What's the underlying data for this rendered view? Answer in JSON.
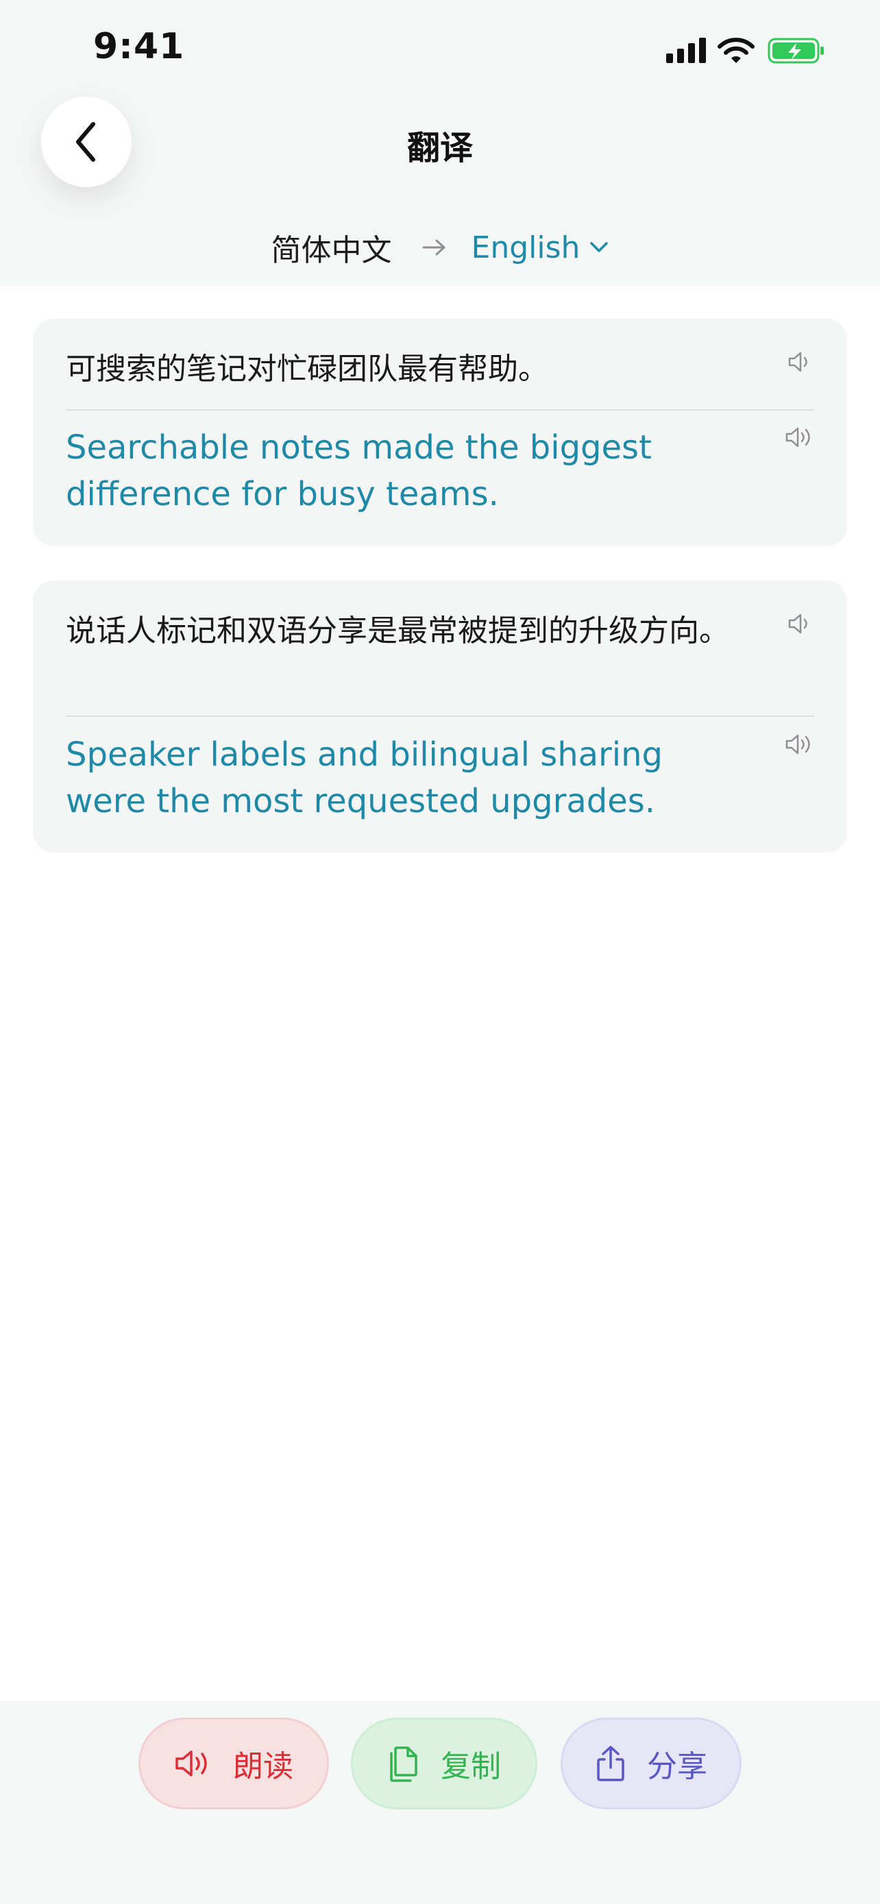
{
  "status_bar": {
    "time": "9:41"
  },
  "header": {
    "title": "翻译"
  },
  "language_bar": {
    "source": "简体中文",
    "target": "English"
  },
  "translations": [
    {
      "source": "可搜索的笔记对忙碌团队最有帮助。",
      "target": "Searchable notes made the biggest difference for busy teams."
    },
    {
      "source": "说话人标记和双语分享是最常被提到的升级方向。",
      "target": "Speaker labels and bilingual sharing were the most requested upgrades."
    }
  ],
  "actions": {
    "read": "朗读",
    "copy": "复制",
    "share": "分享"
  },
  "colors": {
    "accent": "#1e8aa8",
    "read": "#d93038",
    "copy": "#34b451",
    "share": "#5a56c4",
    "battery": "#34c759"
  },
  "icons": {
    "back": "chevron-left-icon",
    "language_arrow": "arrow-right-icon",
    "dropdown": "chevron-down-icon",
    "speaker": "speaker-icon",
    "copy": "copy-icon",
    "share": "share-icon"
  }
}
